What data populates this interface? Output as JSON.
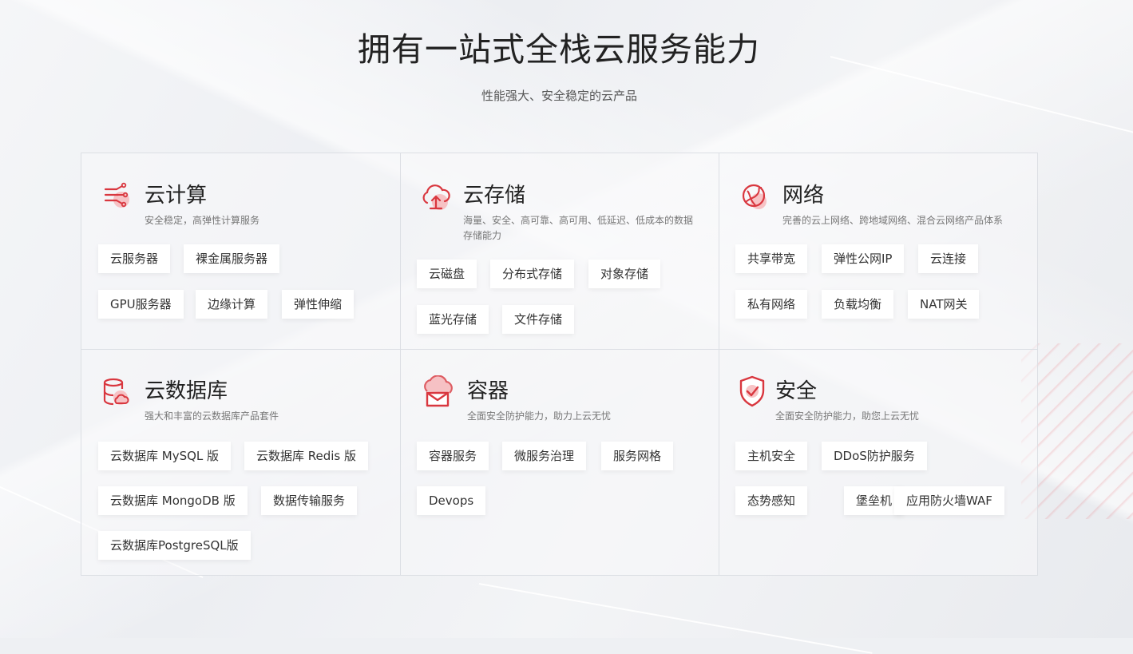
{
  "header": {
    "title": "拥有一站式全栈云服务能力",
    "subtitle": "性能强大、安全稳定的云产品"
  },
  "categories": [
    {
      "title": "云计算",
      "icon": "compute-icon",
      "desc": "安全稳定，高弹性计算服务",
      "tags": [
        "云服务器",
        "裸金属服务器",
        "GPU服务器",
        "边缘计算",
        "弹性伸缩"
      ]
    },
    {
      "title": "云存储",
      "icon": "cloud-upload-icon",
      "desc": "海量、安全、高可靠、高可用、低延迟、低成本的数据存储能力",
      "tags": [
        "云磁盘",
        "分布式存储",
        "对象存储",
        "蓝光存储",
        "文件存储"
      ]
    },
    {
      "title": "网络",
      "icon": "network-globe-icon",
      "desc": "完善的云上网络、跨地域网络、混合云网络产品体系",
      "tags": [
        "共享带宽",
        "弹性公网IP",
        "云连接",
        "私有网络",
        "负载均衡",
        "NAT网关"
      ]
    },
    {
      "title": "云数据库",
      "icon": "database-icon",
      "desc": "强大和丰富的云数据库产品套件",
      "tags": [
        "云数据库 MySQL 版",
        "云数据库 Redis 版",
        "云数据库 MongoDB 版",
        "数据传输服务",
        "云数据库PostgreSQL版"
      ]
    },
    {
      "title": "容器",
      "icon": "container-icon",
      "desc": "全面安全防护能力，助力上云无忧",
      "tags": [
        "容器服务",
        "微服务治理",
        "服务网格",
        "Devops"
      ]
    },
    {
      "title": "安全",
      "icon": "shield-check-icon",
      "desc": "全面安全防护能力，助您上云无忧",
      "tags": [
        "主机安全",
        "DDoS防护服务",
        "态势感知",
        "堡垒机",
        "应用防火墙WAF"
      ]
    }
  ],
  "colors": {
    "accent": "#d9373f",
    "accent_light": "#f6b5b8"
  }
}
